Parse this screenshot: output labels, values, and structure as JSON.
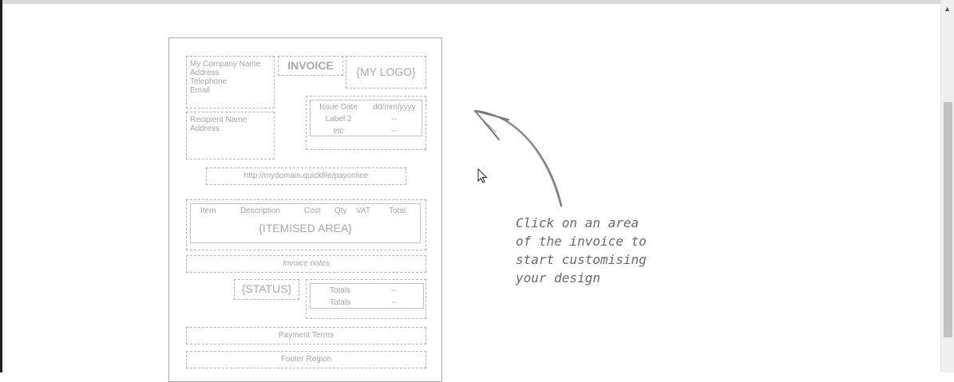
{
  "invoice": {
    "sender": {
      "company": "My Company Name",
      "address": "Address",
      "telephone": "Telephone",
      "email": "Email"
    },
    "title": "INVOICE",
    "logo": "{MY LOGO}",
    "recipient": {
      "name": "Recipient Name",
      "address": "Address"
    },
    "details": [
      {
        "label": "Issue Date",
        "value": "dd/mm/yyyy"
      },
      {
        "label": "Label 2",
        "value": "--"
      },
      {
        "label": "etc",
        "value": "--"
      }
    ],
    "pay_link": "http://mydomain.quickfile/payonline",
    "items": {
      "headers": [
        "Item",
        "Description",
        "Cost",
        "Qty",
        "VAT",
        "Total"
      ],
      "placeholder": "{ITEMISED AREA}"
    },
    "notes": "Invoice notes",
    "status": "{STATUS}",
    "totals": [
      {
        "label": "Totals",
        "value": "--"
      },
      {
        "label": "Totals",
        "value": "--"
      }
    ],
    "payment_terms": "Payment Terms",
    "footer": "Footer Region"
  },
  "callout": {
    "line1": "Click on an area",
    "line2": "of the invoice to",
    "line3": "start customising",
    "line4": "your design"
  },
  "icons": {
    "arrow": "curved-arrow-icon",
    "cursor": "mouse-cursor-icon"
  }
}
